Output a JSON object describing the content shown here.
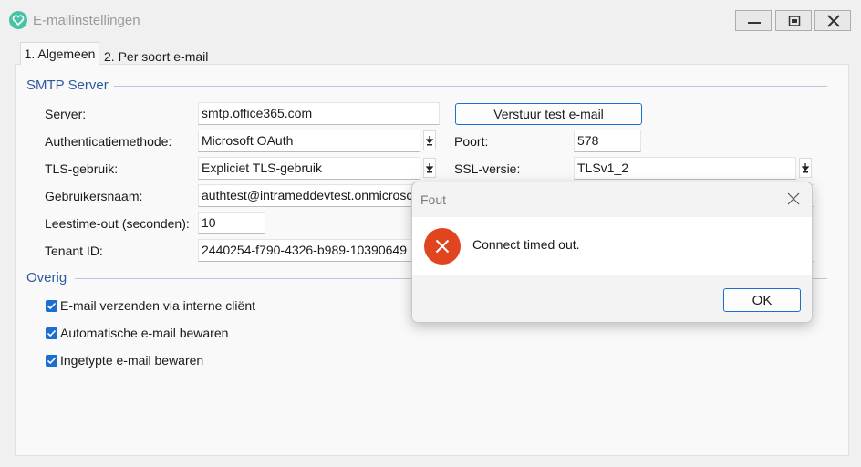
{
  "window": {
    "title": "E-mailinstellingen",
    "controls": {
      "minimize": "minimize-icon",
      "maximize": "maximize-icon",
      "close": "close-icon"
    }
  },
  "tabs": [
    {
      "label": "1. Algemeen",
      "active": true
    },
    {
      "label": "2. Per soort e-mail",
      "active": false
    }
  ],
  "smtp": {
    "group_title": "SMTP Server",
    "server_label": "Server:",
    "server_value": "smtp.office365.com",
    "auth_label": "Authenticatiemethode:",
    "auth_value": "Microsoft OAuth",
    "tls_label": "TLS-gebruik:",
    "tls_value": "Expliciet TLS-gebruik",
    "user_label": "Gebruikersnaam:",
    "user_value": "authtest@intrameddevtest.onmicrosoft.com",
    "timeout_label": "Leestime-out (seconden):",
    "timeout_value": "10",
    "tenant_label": "Tenant ID:",
    "tenant_value": "2440254-f790-4326-b989-10390649",
    "test_button": "Verstuur test e-mail",
    "port_label": "Poort:",
    "port_value": "578",
    "ssl_label": "SSL-versie:",
    "ssl_value": "TLSv1_2"
  },
  "other": {
    "group_title": "Overig",
    "checkboxes": [
      {
        "label": "E-mail verzenden via interne cliënt",
        "checked": true
      },
      {
        "label": "Automatische e-mail bewaren",
        "checked": true
      },
      {
        "label": "Ingetypte e-mail bewaren",
        "checked": true
      }
    ]
  },
  "dialog": {
    "title": "Fout",
    "message": "Connect timed out.",
    "ok_label": "OK",
    "icon": "error-icon"
  },
  "colors": {
    "accent": "#1a6fd0",
    "group_title": "#2c5aa0",
    "error": "#e0451f",
    "app_icon": "#49c3a6"
  }
}
